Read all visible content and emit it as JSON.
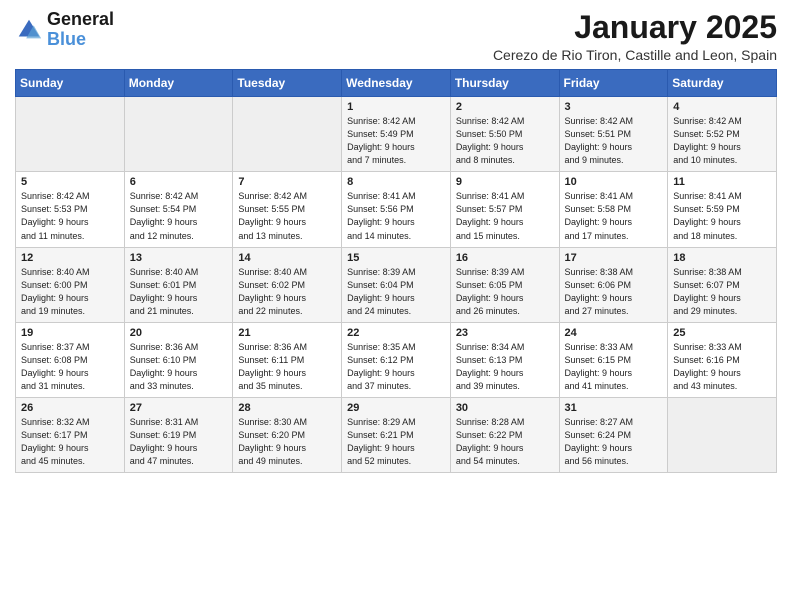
{
  "logo": {
    "text_general": "General",
    "text_blue": "Blue"
  },
  "calendar": {
    "title": "January 2025",
    "subtitle": "Cerezo de Rio Tiron, Castille and Leon, Spain"
  },
  "weekdays": [
    "Sunday",
    "Monday",
    "Tuesday",
    "Wednesday",
    "Thursday",
    "Friday",
    "Saturday"
  ],
  "weeks": [
    [
      {
        "day": "",
        "info": ""
      },
      {
        "day": "",
        "info": ""
      },
      {
        "day": "",
        "info": ""
      },
      {
        "day": "1",
        "info": "Sunrise: 8:42 AM\nSunset: 5:49 PM\nDaylight: 9 hours\nand 7 minutes."
      },
      {
        "day": "2",
        "info": "Sunrise: 8:42 AM\nSunset: 5:50 PM\nDaylight: 9 hours\nand 8 minutes."
      },
      {
        "day": "3",
        "info": "Sunrise: 8:42 AM\nSunset: 5:51 PM\nDaylight: 9 hours\nand 9 minutes."
      },
      {
        "day": "4",
        "info": "Sunrise: 8:42 AM\nSunset: 5:52 PM\nDaylight: 9 hours\nand 10 minutes."
      }
    ],
    [
      {
        "day": "5",
        "info": "Sunrise: 8:42 AM\nSunset: 5:53 PM\nDaylight: 9 hours\nand 11 minutes."
      },
      {
        "day": "6",
        "info": "Sunrise: 8:42 AM\nSunset: 5:54 PM\nDaylight: 9 hours\nand 12 minutes."
      },
      {
        "day": "7",
        "info": "Sunrise: 8:42 AM\nSunset: 5:55 PM\nDaylight: 9 hours\nand 13 minutes."
      },
      {
        "day": "8",
        "info": "Sunrise: 8:41 AM\nSunset: 5:56 PM\nDaylight: 9 hours\nand 14 minutes."
      },
      {
        "day": "9",
        "info": "Sunrise: 8:41 AM\nSunset: 5:57 PM\nDaylight: 9 hours\nand 15 minutes."
      },
      {
        "day": "10",
        "info": "Sunrise: 8:41 AM\nSunset: 5:58 PM\nDaylight: 9 hours\nand 17 minutes."
      },
      {
        "day": "11",
        "info": "Sunrise: 8:41 AM\nSunset: 5:59 PM\nDaylight: 9 hours\nand 18 minutes."
      }
    ],
    [
      {
        "day": "12",
        "info": "Sunrise: 8:40 AM\nSunset: 6:00 PM\nDaylight: 9 hours\nand 19 minutes."
      },
      {
        "day": "13",
        "info": "Sunrise: 8:40 AM\nSunset: 6:01 PM\nDaylight: 9 hours\nand 21 minutes."
      },
      {
        "day": "14",
        "info": "Sunrise: 8:40 AM\nSunset: 6:02 PM\nDaylight: 9 hours\nand 22 minutes."
      },
      {
        "day": "15",
        "info": "Sunrise: 8:39 AM\nSunset: 6:04 PM\nDaylight: 9 hours\nand 24 minutes."
      },
      {
        "day": "16",
        "info": "Sunrise: 8:39 AM\nSunset: 6:05 PM\nDaylight: 9 hours\nand 26 minutes."
      },
      {
        "day": "17",
        "info": "Sunrise: 8:38 AM\nSunset: 6:06 PM\nDaylight: 9 hours\nand 27 minutes."
      },
      {
        "day": "18",
        "info": "Sunrise: 8:38 AM\nSunset: 6:07 PM\nDaylight: 9 hours\nand 29 minutes."
      }
    ],
    [
      {
        "day": "19",
        "info": "Sunrise: 8:37 AM\nSunset: 6:08 PM\nDaylight: 9 hours\nand 31 minutes."
      },
      {
        "day": "20",
        "info": "Sunrise: 8:36 AM\nSunset: 6:10 PM\nDaylight: 9 hours\nand 33 minutes."
      },
      {
        "day": "21",
        "info": "Sunrise: 8:36 AM\nSunset: 6:11 PM\nDaylight: 9 hours\nand 35 minutes."
      },
      {
        "day": "22",
        "info": "Sunrise: 8:35 AM\nSunset: 6:12 PM\nDaylight: 9 hours\nand 37 minutes."
      },
      {
        "day": "23",
        "info": "Sunrise: 8:34 AM\nSunset: 6:13 PM\nDaylight: 9 hours\nand 39 minutes."
      },
      {
        "day": "24",
        "info": "Sunrise: 8:33 AM\nSunset: 6:15 PM\nDaylight: 9 hours\nand 41 minutes."
      },
      {
        "day": "25",
        "info": "Sunrise: 8:33 AM\nSunset: 6:16 PM\nDaylight: 9 hours\nand 43 minutes."
      }
    ],
    [
      {
        "day": "26",
        "info": "Sunrise: 8:32 AM\nSunset: 6:17 PM\nDaylight: 9 hours\nand 45 minutes."
      },
      {
        "day": "27",
        "info": "Sunrise: 8:31 AM\nSunset: 6:19 PM\nDaylight: 9 hours\nand 47 minutes."
      },
      {
        "day": "28",
        "info": "Sunrise: 8:30 AM\nSunset: 6:20 PM\nDaylight: 9 hours\nand 49 minutes."
      },
      {
        "day": "29",
        "info": "Sunrise: 8:29 AM\nSunset: 6:21 PM\nDaylight: 9 hours\nand 52 minutes."
      },
      {
        "day": "30",
        "info": "Sunrise: 8:28 AM\nSunset: 6:22 PM\nDaylight: 9 hours\nand 54 minutes."
      },
      {
        "day": "31",
        "info": "Sunrise: 8:27 AM\nSunset: 6:24 PM\nDaylight: 9 hours\nand 56 minutes."
      },
      {
        "day": "",
        "info": ""
      }
    ]
  ]
}
